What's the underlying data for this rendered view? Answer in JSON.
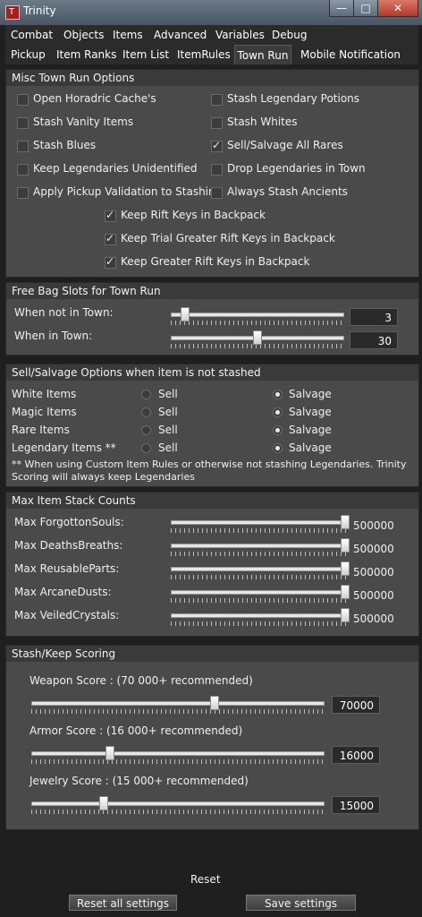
{
  "window": {
    "title": "Trinity",
    "icon": "trinity-app-icon",
    "controls": [
      "minimize-icon",
      "maximize-icon",
      "close-icon"
    ]
  },
  "menu": [
    "Combat",
    "Objects",
    "Items",
    "Advanced",
    "Variables",
    "Debug"
  ],
  "tabs": [
    "Pickup",
    "Item Ranks",
    "Item List",
    "ItemRules",
    "Town Run",
    "Mobile Notification"
  ],
  "active_tab": "Town Run",
  "misc": {
    "title": "Misc Town Run Options",
    "left": [
      {
        "label": "Open Horadric Cache's",
        "checked": false
      },
      {
        "label": "Stash Vanity Items",
        "checked": false
      },
      {
        "label": "Stash Blues",
        "checked": false
      },
      {
        "label": "Keep Legendaries Unidentified",
        "checked": false
      },
      {
        "label": "Apply Pickup Validation to Stashing",
        "checked": false
      }
    ],
    "right": [
      {
        "label": "Stash Legendary Potions",
        "checked": false
      },
      {
        "label": "Stash Whites",
        "checked": false
      },
      {
        "label": "Sell/Salvage All Rares",
        "checked": true
      },
      {
        "label": "Drop Legendaries in Town",
        "checked": false
      },
      {
        "label": "Always Stash Ancients",
        "checked": false
      }
    ],
    "center": [
      {
        "label": "Keep Rift Keys in Backpack",
        "checked": true
      },
      {
        "label": "Keep Trial Greater Rift Keys in Backpack",
        "checked": true
      },
      {
        "label": "Keep Greater Rift Keys in Backpack",
        "checked": true
      }
    ]
  },
  "bag": {
    "title": "Free Bag Slots for Town Run",
    "rows": [
      {
        "label": "When not in Town:",
        "value": "3",
        "fraction": 0.06
      },
      {
        "label": "When in Town:",
        "value": "30",
        "fraction": 0.5
      }
    ]
  },
  "sell": {
    "title": "Sell/Salvage Options when item is not stashed",
    "sell_label": "Sell",
    "salvage_label": "Salvage",
    "rows": [
      {
        "label": "White Items",
        "choice": "salvage"
      },
      {
        "label": "Magic Items",
        "choice": "salvage"
      },
      {
        "label": "Rare Items",
        "choice": "salvage"
      },
      {
        "label": "Legendary Items **",
        "choice": "salvage"
      }
    ],
    "note": "** When using Custom Item Rules or otherwise not stashing Legendaries. Trinity Scoring will always keep Legendaries"
  },
  "stack": {
    "title": "Max Item Stack Counts",
    "rows": [
      {
        "label": "Max ForgottonSouls:",
        "value": "500000",
        "fraction": 1.0
      },
      {
        "label": "Max DeathsBreaths:",
        "value": "500000",
        "fraction": 1.0
      },
      {
        "label": "Max ReusableParts:",
        "value": "500000",
        "fraction": 1.0
      },
      {
        "label": "Max ArcaneDusts:",
        "value": "500000",
        "fraction": 1.0
      },
      {
        "label": "Max VeiledCrystals:",
        "value": "500000",
        "fraction": 1.0
      }
    ]
  },
  "score": {
    "title": "Stash/Keep Scoring",
    "rows": [
      {
        "label": "Weapon Score : (70 000+ recommended)",
        "value": "70000",
        "fraction": 0.63
      },
      {
        "label": "Armor Score : (16 000+ recommended)",
        "value": "16000",
        "fraction": 0.26
      },
      {
        "label": "Jewelry Score : (15 000+ recommended)",
        "value": "15000",
        "fraction": 0.24
      }
    ]
  },
  "buttons": {
    "reset": "Reset",
    "reset_all": "Reset all settings",
    "save": "Save settings"
  }
}
